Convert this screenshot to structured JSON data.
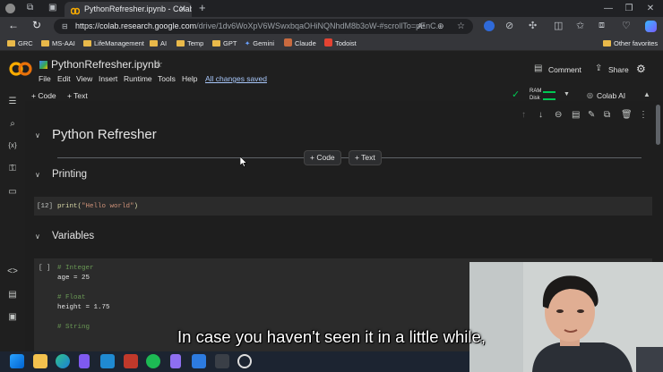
{
  "browser": {
    "tab_title": "PythonRefresher.ipynb - Colabora",
    "new_tab": "+",
    "url_host": "https://colab.research.google.com",
    "url_path": "/drive/1dv6WoXpV6WSwxbqaOHiNQNhdM8b3oW-#scrollTo=pEnC..."
  },
  "bookmarks": [
    {
      "label": "GRC",
      "icon": "folder-icon"
    },
    {
      "label": "MS-AAI",
      "icon": "folder-icon"
    },
    {
      "label": "LifeManagement",
      "icon": "folder-icon"
    },
    {
      "label": "AI",
      "icon": "folder-icon"
    },
    {
      "label": "Temp",
      "icon": "folder-icon"
    },
    {
      "label": "GPT",
      "icon": "folder-icon"
    },
    {
      "label": "Gemini",
      "icon": "gemini-icon"
    },
    {
      "label": "Claude",
      "icon": "claude-icon"
    },
    {
      "label": "Todoist",
      "icon": "todoist-icon"
    }
  ],
  "other_favorites": "Other favorites",
  "colab": {
    "notebook_title": "PythonRefresher.ipynb",
    "menu": [
      "File",
      "Edit",
      "View",
      "Insert",
      "Runtime",
      "Tools",
      "Help"
    ],
    "saved_status": "All changes saved",
    "comment": "Comment",
    "share": "Share",
    "add_code": "+ Code",
    "add_text": "+ Text",
    "ram": "RAM",
    "disk": "Disk",
    "colab_ai": "Colab AI"
  },
  "notebook": {
    "heading": "Python Refresher",
    "insert_code": "+ Code",
    "insert_text": "+ Text",
    "section_printing": "Printing",
    "cell1_count": "[12]",
    "cell1_code_fn": "print(",
    "cell1_code_str": "\"Hello world\"",
    "cell1_code_end": ")",
    "section_variables": "Variables",
    "cell2_count": "[ ]",
    "cell2_lines": [
      {
        "text": "# Integer",
        "kind": "comment"
      },
      {
        "text": "age = 25",
        "kind": "code"
      },
      {
        "text": "",
        "kind": "blank"
      },
      {
        "text": "# Float",
        "kind": "comment"
      },
      {
        "text": "height = 1.75",
        "kind": "code"
      },
      {
        "text": "",
        "kind": "blank"
      },
      {
        "text": "# String",
        "kind": "comment"
      }
    ]
  },
  "subtitle": "In case you haven't seen it in a little while,",
  "colors": {
    "accent": "#a8c7fa",
    "comment": "#6a9955",
    "string": "#ce9178",
    "ram_ok": "#00c853",
    "logo_orange": "#f9ab00"
  }
}
